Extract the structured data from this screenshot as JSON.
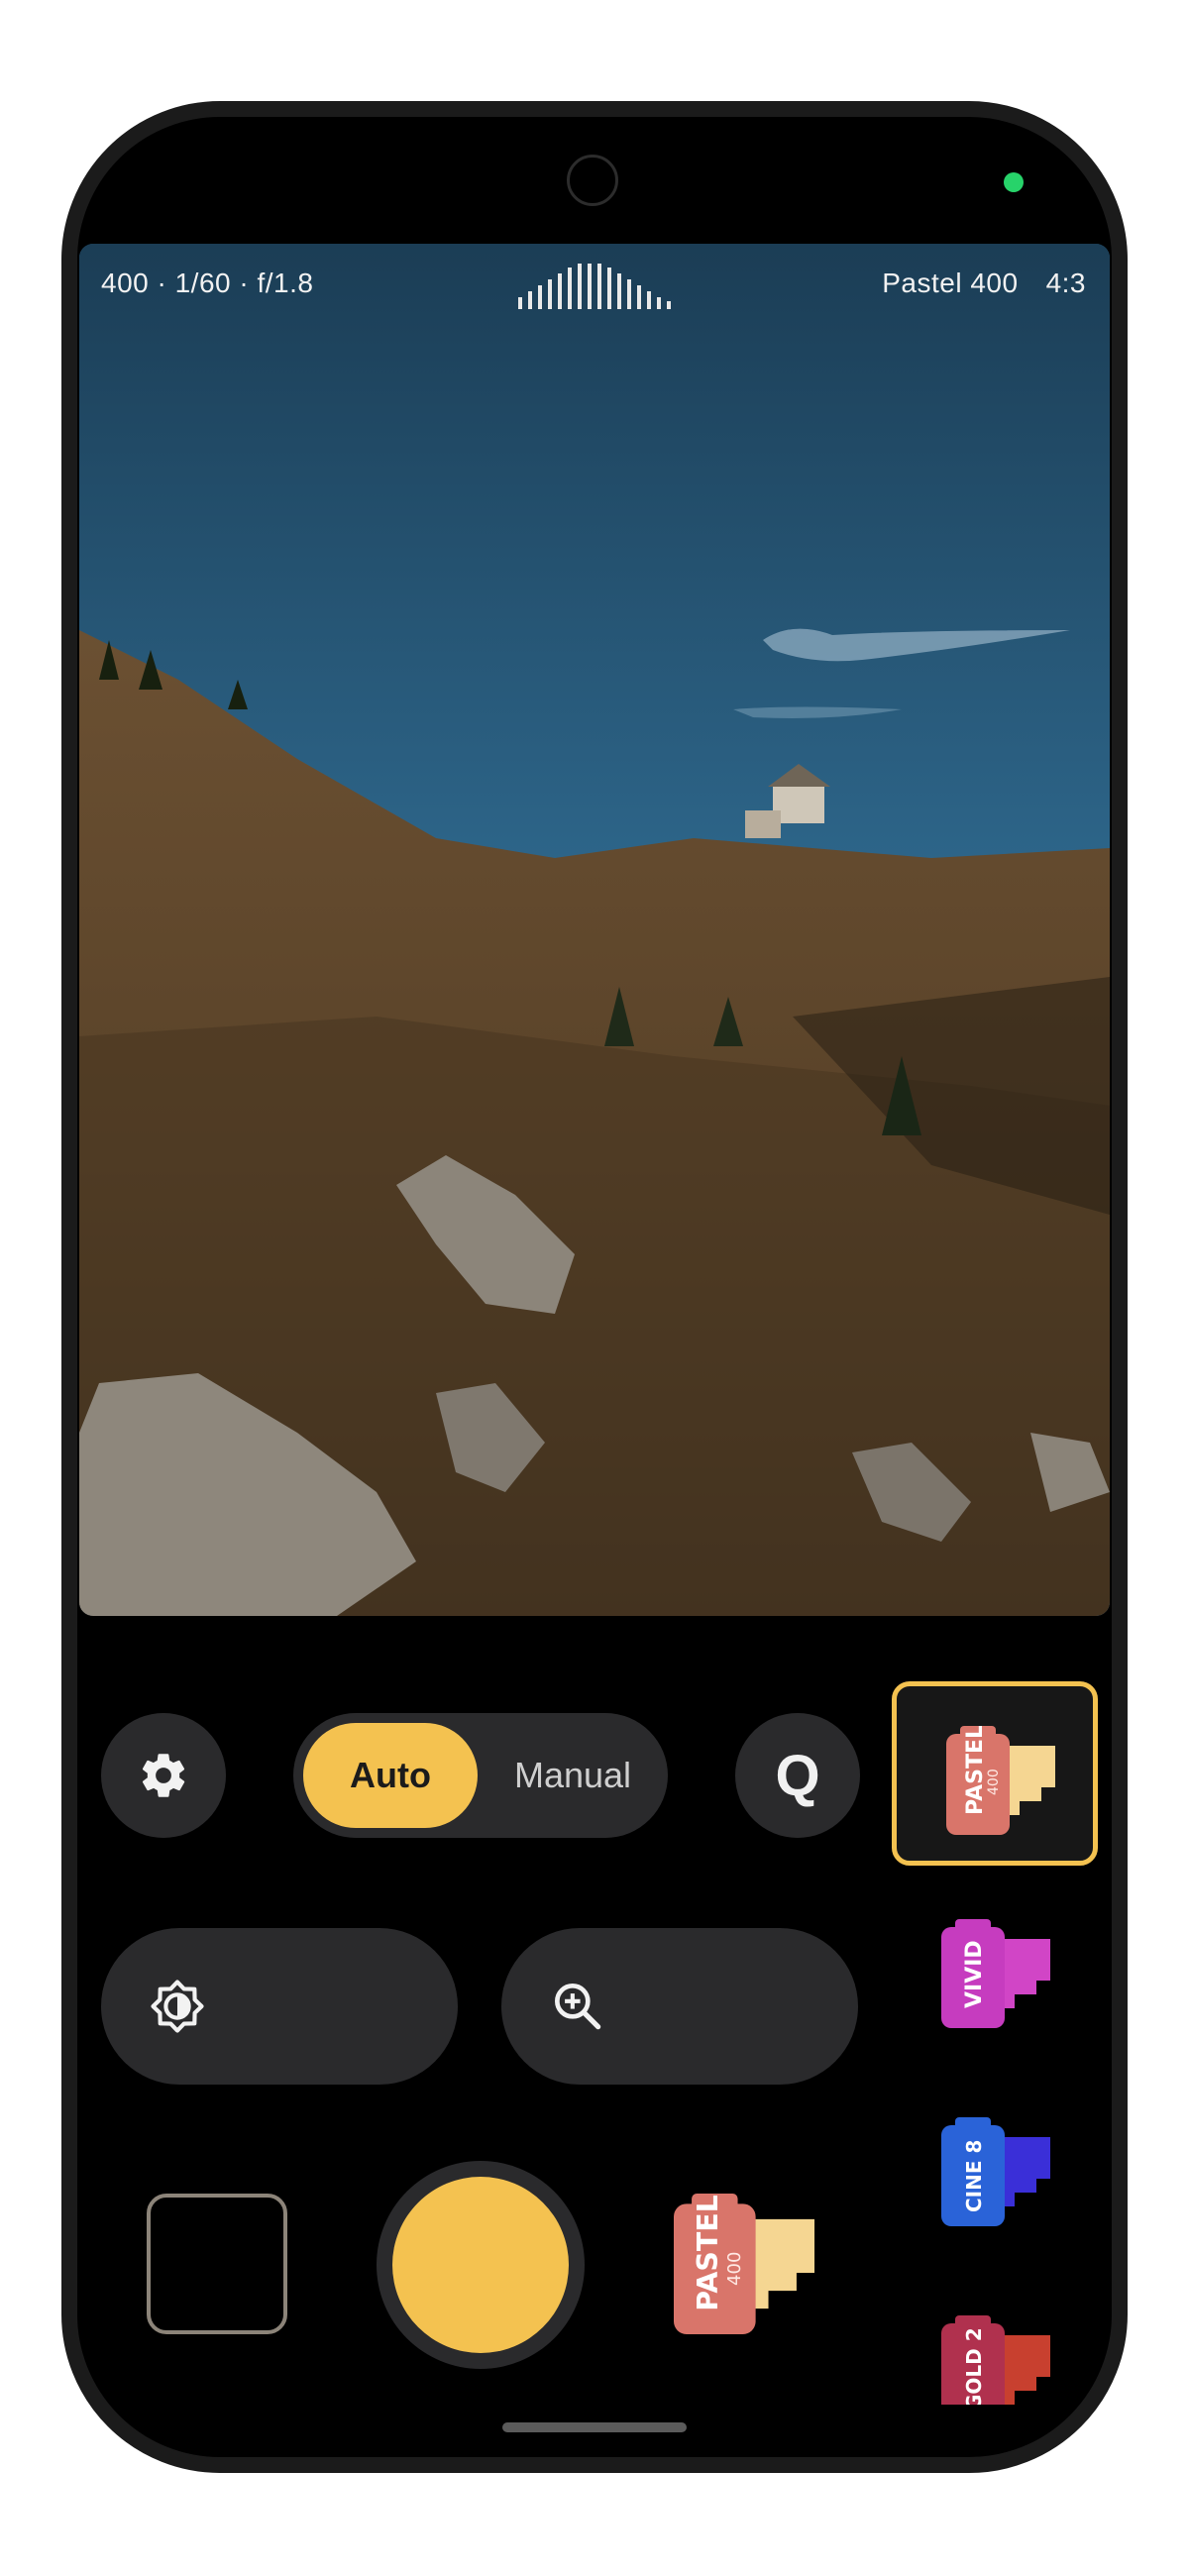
{
  "viewfinder": {
    "exposure": "400 · 1/60 · f/1.8",
    "film_name": "Pastel 400",
    "aspect_ratio": "4:3"
  },
  "controls": {
    "settings_icon": "gear-icon",
    "mode_options": [
      "Auto",
      "Manual"
    ],
    "selected_mode": "Auto",
    "quick_label": "Q",
    "brightness_icon": "brightness-icon",
    "zoom_icon": "zoom-in-icon"
  },
  "current_film": {
    "name": "PASTEL",
    "speed": "400"
  },
  "film_strip": [
    {
      "name": "PASTEL",
      "speed": "400",
      "selected": true
    },
    {
      "name": "VIVID",
      "speed": ""
    },
    {
      "name": "CINE 8",
      "speed": ""
    },
    {
      "name": "GOLD 2",
      "speed": ""
    }
  ],
  "colors": {
    "accent": "#f4c250",
    "button_bg": "#2a2a2c",
    "pastel": "#d9756a",
    "vivid": "#c63cbf",
    "cine8": "#2a63d8",
    "gold2": "#b0314e"
  }
}
